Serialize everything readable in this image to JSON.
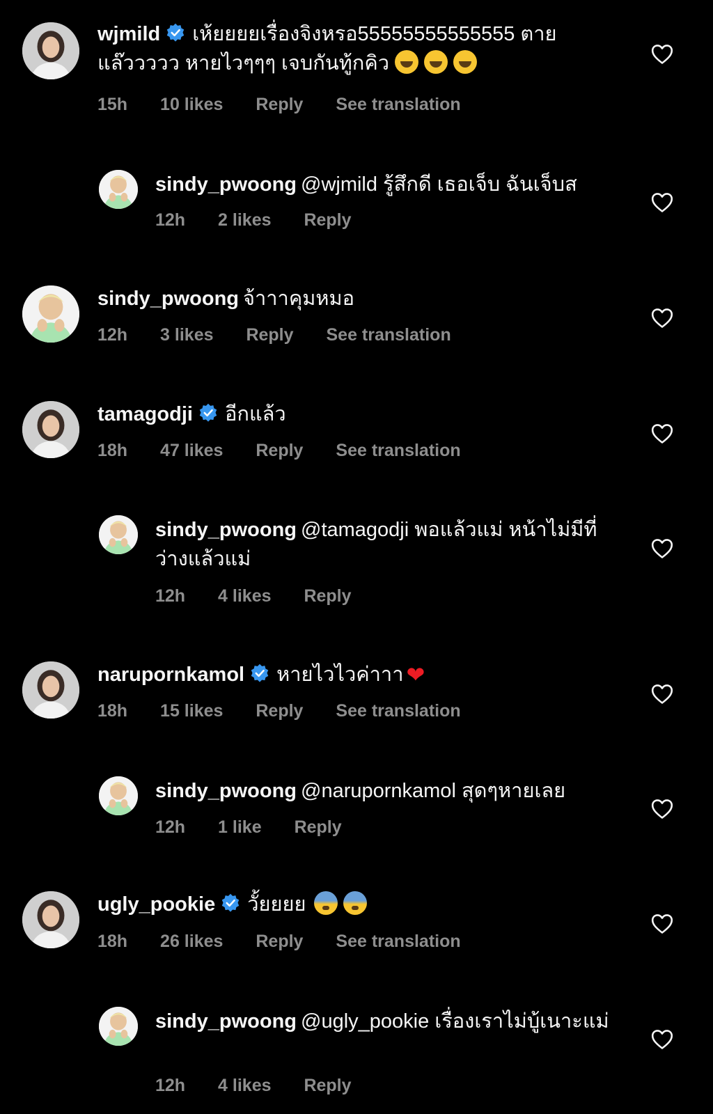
{
  "colors": {
    "background": "#000000",
    "text": "#f5f5f5",
    "meta": "#8e8e8e",
    "verified": "#3897f0"
  },
  "comments": [
    {
      "username": "wjmild",
      "verified": true,
      "text": "เห้ยยยยเรื่องจิงหรอ55555555555555 ตายแล๊ววววว หายไวๆๆๆ เจบกันทู้กคิว",
      "emoji": "🤣🤣🤣",
      "time": "15h",
      "likes": "10 likes",
      "reply": "Reply",
      "translation": "See translation",
      "avatar_icon": "avatar-woman"
    },
    {
      "username": "sindy_pwoong",
      "verified": false,
      "text": "@wjmild รู้สึกดี เธอเจ็บ ฉันเจ็บส",
      "time": "12h",
      "likes": "2 likes",
      "reply": "Reply",
      "avatar_icon": "avatar-man"
    },
    {
      "username": "sindy_pwoong",
      "verified": false,
      "text": "จ้าาาคุมหมอ",
      "time": "12h",
      "likes": "3 likes",
      "reply": "Reply",
      "translation": "See translation",
      "avatar_icon": "avatar-man"
    },
    {
      "username": "tamagodji",
      "verified": true,
      "text": "อีกแล้ว",
      "time": "18h",
      "likes": "47 likes",
      "reply": "Reply",
      "translation": "See translation",
      "avatar_icon": "avatar-woman"
    },
    {
      "username": "sindy_pwoong",
      "verified": false,
      "text": "@tamagodji พอแล้วแม่ หน้าไม่มีที่ว่างแล้วแม่",
      "time": "12h",
      "likes": "4 likes",
      "reply": "Reply",
      "avatar_icon": "avatar-man"
    },
    {
      "username": "narupornkamol",
      "verified": true,
      "text": "หายไวไวค่าาา",
      "emoji": "❤️",
      "time": "18h",
      "likes": "15 likes",
      "reply": "Reply",
      "translation": "See translation",
      "avatar_icon": "avatar-woman"
    },
    {
      "username": "sindy_pwoong",
      "verified": false,
      "text": "@narupornkamol สุดๆหายเลย",
      "time": "12h",
      "likes": "1 like",
      "reply": "Reply",
      "avatar_icon": "avatar-man"
    },
    {
      "username": "ugly_pookie",
      "verified": true,
      "text": "วั้ยยยย",
      "emoji": "😰😰",
      "time": "18h",
      "likes": "26 likes",
      "reply": "Reply",
      "translation": "See translation",
      "avatar_icon": "avatar-woman"
    },
    {
      "username": "sindy_pwoong",
      "verified": false,
      "text": "@ugly_pookie เรื่องเราไม่บู้เนาะแม่",
      "time": "12h",
      "likes": "4 likes",
      "reply": "Reply",
      "avatar_icon": "avatar-man"
    }
  ]
}
